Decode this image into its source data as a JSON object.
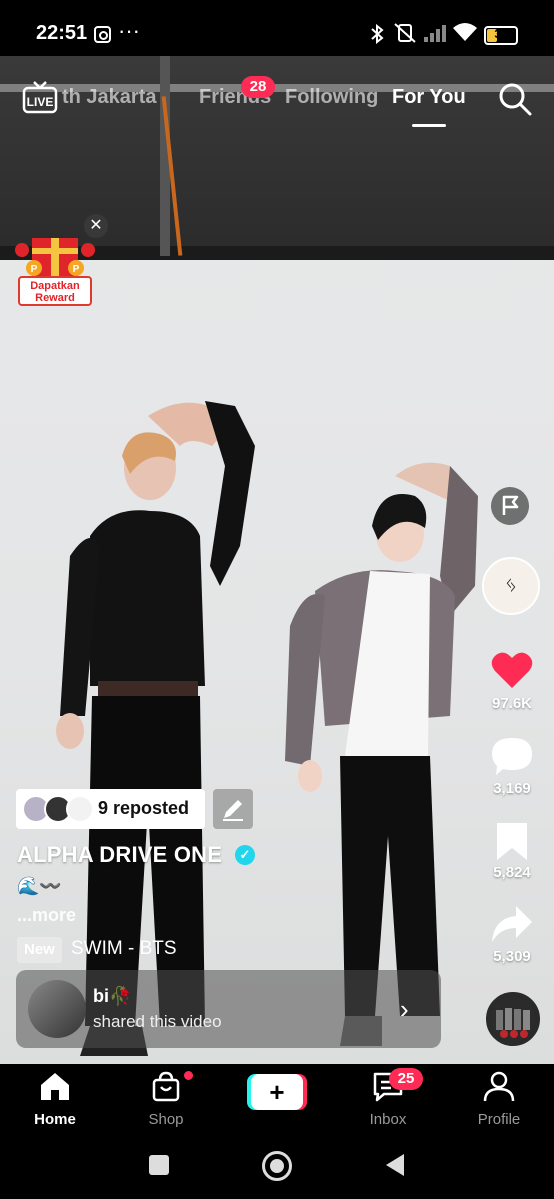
{
  "status_bar": {
    "time": "22:51",
    "more": "···",
    "battery": "32"
  },
  "top_nav": {
    "tabs": [
      "th Jakarta",
      "Friends",
      "Following",
      "For You"
    ],
    "friends_badge": "28",
    "active_tab": "For You",
    "live_label": "LIVE"
  },
  "reward": {
    "label": "Dapatkan Reward",
    "close": "✕",
    "coin": "P"
  },
  "right_rail": {
    "creator_logo": "ᛃ",
    "likes": "97.6K",
    "comments": "3,169",
    "saves": "5,824",
    "shares": "5,309",
    "like_color": "#fe2c55"
  },
  "post": {
    "repost_text": "9 reposted",
    "author": "ALPHA DRIVE ONE",
    "caption": "🌊〰️",
    "more": "...more",
    "new_badge": "New",
    "song": "SWIM - BTS"
  },
  "share_card": {
    "name": "bi🥀",
    "subtitle": "shared this video",
    "chevron": "›"
  },
  "bottom_nav": {
    "items": [
      "Home",
      "Shop",
      "Inbox",
      "Profile"
    ],
    "inbox_badge": "25",
    "plus": "+"
  }
}
